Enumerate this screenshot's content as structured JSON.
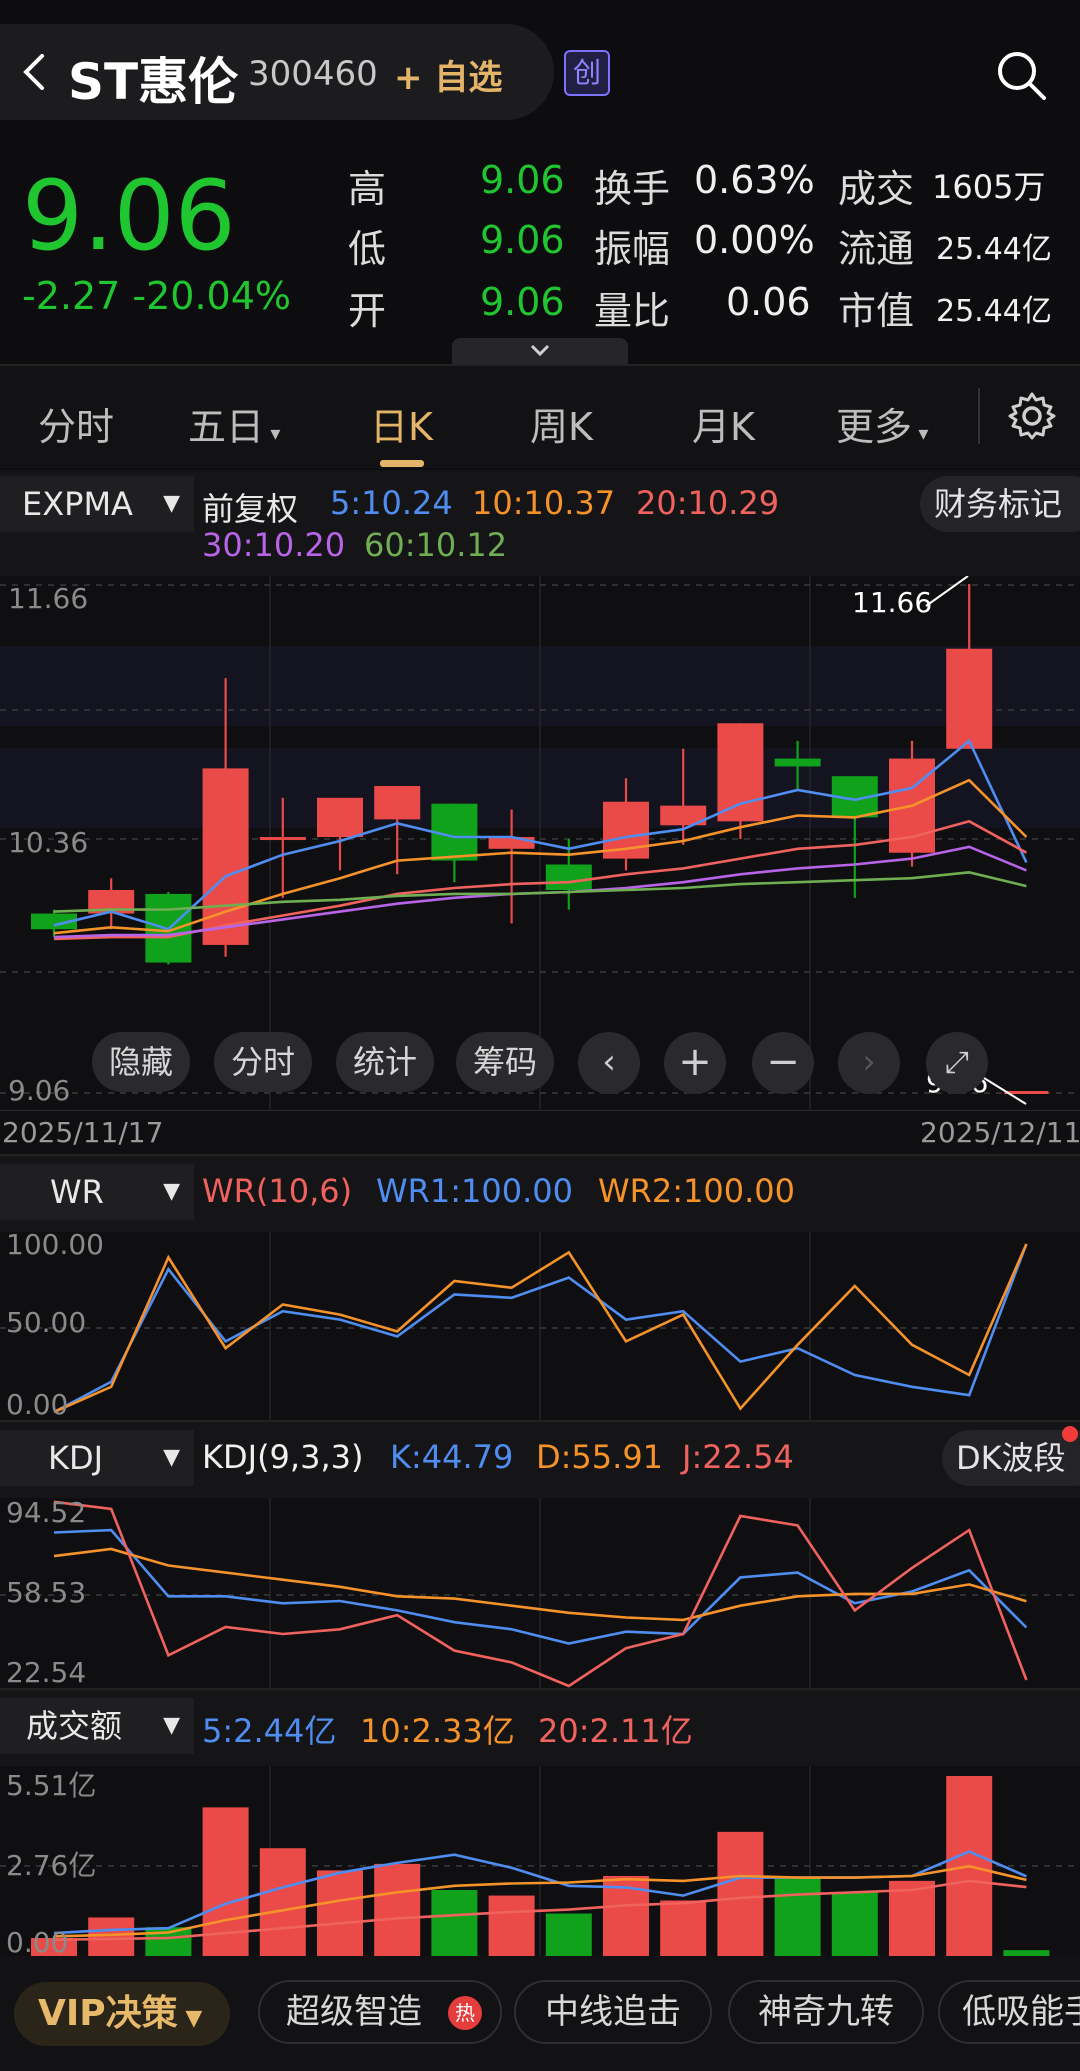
{
  "header": {
    "title": "ST惠伦",
    "code": "300460",
    "add_watch": "+ 自选",
    "market_badge": "创"
  },
  "quote": {
    "price": "9.06",
    "change": "-2.27 -20.04%",
    "stats": [
      {
        "label": "高",
        "value": "9.06"
      },
      {
        "label": "低",
        "value": "9.06"
      },
      {
        "label": "开",
        "value": "9.06"
      },
      {
        "label": "换手",
        "value": "0.63%"
      },
      {
        "label": "振幅",
        "value": "0.00%"
      },
      {
        "label": "量比",
        "value": "0.06"
      },
      {
        "label": "成交",
        "value": "1605万"
      },
      {
        "label": "流通",
        "value": "25.44亿"
      },
      {
        "label": "市值",
        "value": "25.44亿"
      }
    ]
  },
  "tabs": [
    "分时",
    "五日",
    "日K",
    "周K",
    "月K",
    "更多"
  ],
  "active_tab": "日K",
  "main_chart": {
    "indicator": "EXPMA",
    "adjust": "前复权",
    "ma": [
      {
        "label": "5:10.24",
        "color": "#4f8df0"
      },
      {
        "label": "10:10.37",
        "color": "#f5922a"
      },
      {
        "label": "20:10.29",
        "color": "#f0625e"
      },
      {
        "label": "30:10.20",
        "color": "#b864e8"
      },
      {
        "label": "60:10.12",
        "color": "#6fae52"
      }
    ],
    "finance_btn": "财务标记",
    "y_labels": [
      "11.66",
      "10.36",
      "9.06"
    ],
    "high_mark": "11.66",
    "low_mark": "9.06",
    "controls": [
      "隐藏",
      "分时",
      "统计",
      "筹码"
    ],
    "date_start": "2025/11/17",
    "date_end": "2025/12/11"
  },
  "wr": {
    "selector": "WR",
    "params": "WR(10,6)",
    "wr1": "WR1:100.00",
    "wr2": "WR2:100.00",
    "y_labels": [
      "100.00",
      "50.00",
      "0.00"
    ]
  },
  "kdj": {
    "selector": "KDJ",
    "params": "KDJ(9,3,3)",
    "k": "K:44.79",
    "d": "D:55.91",
    "j": "J:22.54",
    "btn": "DK波段",
    "y_labels": [
      "94.52",
      "58.53",
      "22.54"
    ]
  },
  "volume": {
    "selector": "成交额",
    "ma5": "5:2.44亿",
    "ma10": "10:2.33亿",
    "ma20": "20:2.11亿",
    "y_labels": [
      "5.51亿",
      "2.76亿",
      "0.00"
    ]
  },
  "bottom": {
    "vip": "VIP决策",
    "chips": [
      "超级智造",
      "中线追击",
      "神奇九转",
      "低吸能手"
    ],
    "hot": "热"
  },
  "chart_data": [
    {
      "type": "candlestick",
      "title": "",
      "dates": [
        "2025/11/17",
        "",
        "",
        "",
        "",
        "",
        "",
        "",
        "",
        "",
        "",
        "",
        "",
        "",
        "",
        "",
        "",
        "2025/12/11"
      ],
      "ohlc": [
        {
          "o": 9.98,
          "h": 10.0,
          "l": 9.86,
          "c": 9.9
        },
        {
          "o": 9.98,
          "h": 10.16,
          "l": 9.9,
          "c": 10.1
        },
        {
          "o": 10.08,
          "h": 10.09,
          "l": 9.72,
          "c": 9.73
        },
        {
          "o": 9.82,
          "h": 11.18,
          "l": 9.76,
          "c": 10.72
        },
        {
          "o": 10.36,
          "h": 10.57,
          "l": 10.06,
          "c": 10.37
        },
        {
          "o": 10.37,
          "h": 10.48,
          "l": 10.2,
          "c": 10.57
        },
        {
          "o": 10.46,
          "h": 10.59,
          "l": 10.18,
          "c": 10.63
        },
        {
          "o": 10.54,
          "h": 10.54,
          "l": 10.14,
          "c": 10.25
        },
        {
          "o": 10.31,
          "h": 10.51,
          "l": 9.93,
          "c": 10.37
        },
        {
          "o": 10.23,
          "h": 10.36,
          "l": 10.0,
          "c": 10.1
        },
        {
          "o": 10.26,
          "h": 10.67,
          "l": 10.2,
          "c": 10.55
        },
        {
          "o": 10.43,
          "h": 10.82,
          "l": 10.33,
          "c": 10.53
        },
        {
          "o": 10.45,
          "h": 10.95,
          "l": 10.36,
          "c": 10.95
        },
        {
          "o": 10.77,
          "h": 10.86,
          "l": 10.61,
          "c": 10.73
        },
        {
          "o": 10.68,
          "h": 10.68,
          "l": 10.06,
          "c": 10.47
        },
        {
          "o": 10.29,
          "h": 10.86,
          "l": 10.22,
          "c": 10.77
        },
        {
          "o": 10.82,
          "h": 11.66,
          "l": 10.82,
          "c": 11.33
        },
        {
          "o": 9.06,
          "h": 9.06,
          "l": 9.06,
          "c": 9.06
        }
      ],
      "ylim": [
        9.06,
        11.66
      ],
      "series": [
        {
          "name": "5",
          "color": "#4f8df0",
          "values": [
            9.92,
            9.99,
            9.9,
            10.17,
            10.28,
            10.35,
            10.44,
            10.37,
            10.37,
            10.31,
            10.37,
            10.41,
            10.54,
            10.61,
            10.56,
            10.62,
            10.86,
            10.24
          ]
        },
        {
          "name": "10",
          "color": "#f5922a",
          "values": [
            9.88,
            9.91,
            9.89,
            9.99,
            10.08,
            10.16,
            10.25,
            10.27,
            10.29,
            10.28,
            10.31,
            10.35,
            10.42,
            10.48,
            10.47,
            10.53,
            10.66,
            10.37
          ]
        },
        {
          "name": "20",
          "color": "#f0625e",
          "values": [
            9.85,
            9.86,
            9.86,
            9.92,
            9.97,
            10.02,
            10.08,
            10.11,
            10.13,
            10.14,
            10.18,
            10.21,
            10.26,
            10.31,
            10.33,
            10.37,
            10.45,
            10.29
          ]
        },
        {
          "name": "30",
          "color": "#b864e8",
          "values": [
            9.86,
            9.87,
            9.87,
            9.91,
            9.95,
            9.99,
            10.03,
            10.06,
            10.08,
            10.09,
            10.11,
            10.14,
            10.18,
            10.21,
            10.23,
            10.26,
            10.32,
            10.2
          ]
        },
        {
          "name": "60",
          "color": "#6fae52",
          "values": [
            9.99,
            10.0,
            10.0,
            10.02,
            10.04,
            10.05,
            10.07,
            10.08,
            10.08,
            10.09,
            10.1,
            10.11,
            10.13,
            10.14,
            10.15,
            10.16,
            10.19,
            10.12
          ]
        }
      ]
    },
    {
      "type": "line",
      "title": "WR",
      "ylim": [
        0,
        100
      ],
      "series": [
        {
          "name": "WR1",
          "color": "#4f8df0",
          "values": [
            0,
            18,
            85,
            42,
            60,
            55,
            45,
            70,
            68,
            80,
            55,
            60,
            30,
            38,
            22,
            15,
            10,
            100
          ]
        },
        {
          "name": "WR2",
          "color": "#f5922a",
          "values": [
            0,
            15,
            92,
            38,
            64,
            58,
            48,
            78,
            74,
            95,
            42,
            58,
            2,
            40,
            75,
            40,
            22,
            100
          ]
        }
      ]
    },
    {
      "type": "line",
      "title": "KDJ(9,3,3)",
      "ylim": [
        22.54,
        94.52
      ],
      "series": [
        {
          "name": "K",
          "color": "#4f8df0",
          "values": [
            85,
            86,
            58,
            58,
            55,
            56,
            52,
            47,
            44,
            38,
            43,
            42,
            66,
            68,
            55,
            60,
            69,
            44.79
          ]
        },
        {
          "name": "D",
          "color": "#f5922a",
          "values": [
            75,
            78,
            71,
            68,
            65,
            62,
            58,
            57,
            54,
            51,
            49,
            48,
            54,
            58,
            59,
            59,
            63,
            55.91
          ]
        },
        {
          "name": "J",
          "color": "#f0625e",
          "values": [
            98,
            95,
            33,
            45,
            42,
            44,
            50,
            35,
            30,
            20,
            36,
            42,
            92,
            88,
            52,
            70,
            86,
            22.54
          ]
        }
      ]
    },
    {
      "type": "bar",
      "title": "成交额",
      "unit": "亿",
      "ylim": [
        0,
        5.51
      ],
      "values": [
        0.55,
        1.18,
        0.88,
        4.55,
        3.3,
        2.62,
        2.82,
        2.02,
        1.85,
        1.3,
        2.45,
        1.7,
        3.8,
        2.4,
        1.95,
        2.3,
        5.51,
        0.18
      ],
      "colors": [
        "up",
        "up",
        "down",
        "up",
        "up",
        "up",
        "up",
        "down",
        "up",
        "down",
        "up",
        "up",
        "up",
        "down",
        "down",
        "up",
        "up",
        "down"
      ],
      "series": [
        {
          "name": "5",
          "color": "#4f8df0",
          "values": [
            0.7,
            0.8,
            0.85,
            1.6,
            2.1,
            2.55,
            2.85,
            3.1,
            2.7,
            2.15,
            2.1,
            1.85,
            2.4,
            2.4,
            2.4,
            2.45,
            3.2,
            2.44
          ]
        },
        {
          "name": "10",
          "color": "#f5922a",
          "values": [
            0.6,
            0.65,
            0.72,
            1.1,
            1.4,
            1.7,
            1.95,
            2.15,
            2.22,
            2.25,
            2.35,
            2.3,
            2.45,
            2.4,
            2.4,
            2.45,
            2.75,
            2.33
          ]
        },
        {
          "name": "20",
          "color": "#f0625e",
          "values": [
            0.5,
            0.52,
            0.55,
            0.7,
            0.85,
            1.0,
            1.15,
            1.25,
            1.35,
            1.42,
            1.55,
            1.62,
            1.78,
            1.88,
            1.95,
            2.02,
            2.3,
            2.11
          ]
        }
      ]
    }
  ],
  "colors": {
    "up": "#ea4a48",
    "down": "#0fa21a",
    "accent": "#e4b468"
  }
}
